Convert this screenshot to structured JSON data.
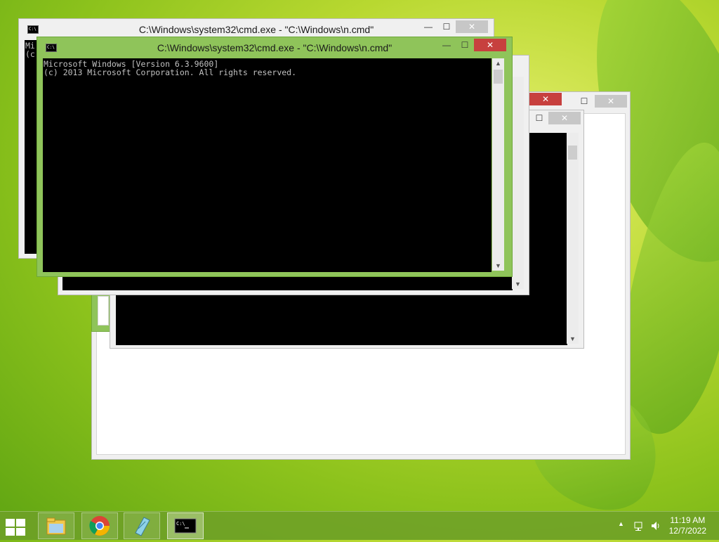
{
  "windows": {
    "back": {
      "title": "C:\\Windows\\system32\\cmd.exe - \"C:\\Windows\\n.cmd\"",
      "console_lines": [
        "Mi",
        "(c"
      ]
    },
    "front": {
      "title": "C:\\Windows\\system32\\cmd.exe - \"C:\\Windows\\n.cmd\"",
      "console_lines": [
        "Microsoft Windows [Version 6.3.9600]",
        "(c) 2013 Microsoft Corporation. All rights reserved."
      ]
    },
    "controls": {
      "minimize": "—",
      "maximize": "☐",
      "close": "✕"
    }
  },
  "taskbar": {
    "items": [
      {
        "name": "file-explorer",
        "icon": "folder-icon"
      },
      {
        "name": "chrome",
        "icon": "chrome-icon"
      },
      {
        "name": "notepad",
        "icon": "notepad-icon"
      },
      {
        "name": "cmd",
        "icon": "cmd-icon",
        "active": true
      }
    ],
    "tray": {
      "expand": "▲",
      "time": "11:19 AM",
      "date": "12/7/2022"
    }
  },
  "colors": {
    "titlebar_active": "#8fc45a",
    "close_red": "#c7403e",
    "taskbar": "#6ea028"
  }
}
